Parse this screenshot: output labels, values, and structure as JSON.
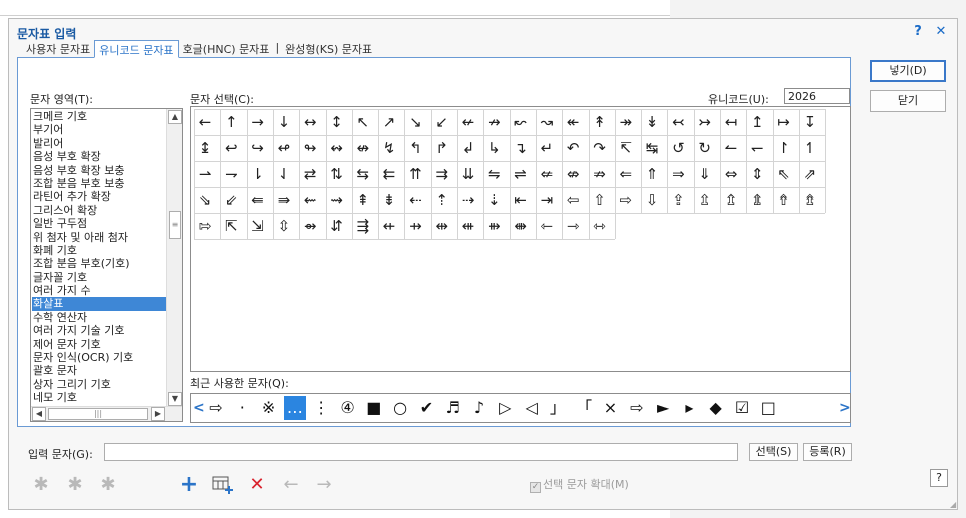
{
  "dialog": {
    "title": "문자표 입력",
    "help_label": "?",
    "close_label": "✕"
  },
  "tabs": [
    {
      "label": "사용자 문자표"
    },
    {
      "label": "유니코드 문자표"
    },
    {
      "label": "호글(HNC) 문자표"
    },
    {
      "label": "완성형(KS) 문자표"
    }
  ],
  "tab_separator": "|",
  "section": {
    "area_label": "문자 영역(T):",
    "select_label": "문자 선택(C):",
    "unicode_label": "유니코드(U):",
    "unicode_value": "2026",
    "recent_label": "최근 사용한 문자(Q):",
    "input_label": "입력 문자(G):",
    "input_value": ""
  },
  "areas": [
    "크메르 기호",
    "부기어",
    "발리어",
    "음성 부호 확장",
    "음성 부호 확장 보충",
    "조합 분음 부호 보충",
    "라틴어 추가 확장",
    "그리스어 확장",
    "일반 구두점",
    "위 첨자 및 아래 첨자",
    "화폐 기호",
    "조합 분음 부호(기호)",
    "글자꼴 기호",
    "여러 가지 수",
    "화살표",
    "수학 연산자",
    "여러 가지 기술 기호",
    "제어 문자 기호",
    "문자 인식(OCR) 기호",
    "괄호 문자",
    "상자 그리기 기호",
    "네모 기호"
  ],
  "selected_area": "화살표",
  "arrows": [
    "←",
    "↑",
    "→",
    "↓",
    "↔",
    "↕",
    "↖",
    "↗",
    "↘",
    "↙",
    "↚",
    "↛",
    "↜",
    "↝",
    "↞",
    "↟",
    "↠",
    "↡",
    "↢",
    "↣",
    "↤",
    "↥",
    "↦",
    "↧",
    "↨",
    "↩",
    "↪",
    "↫",
    "↬",
    "↭",
    "↮",
    "↯",
    "↰",
    "↱",
    "↲",
    "↳",
    "↴",
    "↵",
    "↶",
    "↷",
    "↸",
    "↹",
    "↺",
    "↻",
    "↼",
    "↽",
    "↾",
    "↿",
    "⇀",
    "⇁",
    "⇂",
    "⇃",
    "⇄",
    "⇅",
    "⇆",
    "⇇",
    "⇈",
    "⇉",
    "⇊",
    "⇋",
    "⇌",
    "⇍",
    "⇎",
    "⇏",
    "⇐",
    "⇑",
    "⇒",
    "⇓",
    "⇔",
    "⇕",
    "⇖",
    "⇗",
    "⇘",
    "⇙",
    "⇚",
    "⇛",
    "⇜",
    "⇝",
    "⇞",
    "⇟",
    "⇠",
    "⇡",
    "⇢",
    "⇣",
    "⇤",
    "⇥",
    "⇦",
    "⇧",
    "⇨",
    "⇩",
    "⇪",
    "⇫",
    "⇬",
    "⇭",
    "⇮",
    "⇯",
    "⇰",
    "⇱",
    "⇲",
    "⇳",
    "⇴",
    "⇵",
    "⇶",
    "⇷",
    "⇸",
    "⇹",
    "⇺",
    "⇻",
    "⇼",
    "⇽",
    "⇾",
    "⇿"
  ],
  "recent": [
    "⇨",
    "·",
    "※",
    "…",
    "⋮",
    "④",
    "■",
    "○",
    "✔",
    "♬",
    "♪",
    "▷",
    "◁",
    "」",
    "「",
    "×",
    "⇨",
    "►",
    "▸",
    "◆",
    "☑",
    "□"
  ],
  "buttons": {
    "insert": "넣기(D)",
    "close": "닫기",
    "select": "선택(S)",
    "register": "등록(R)"
  },
  "checkbox": {
    "label": "선택 문자 확대(M)",
    "checked": true
  },
  "toolbar_icons": {
    "add": "+",
    "delete": "✕",
    "prev": "←",
    "next": "→"
  },
  "colors": {
    "accent": "#2b74c8",
    "selected_bg": "#3e87d6",
    "delete_red": "#d9232e",
    "title_blue": "#1a5aa3"
  }
}
